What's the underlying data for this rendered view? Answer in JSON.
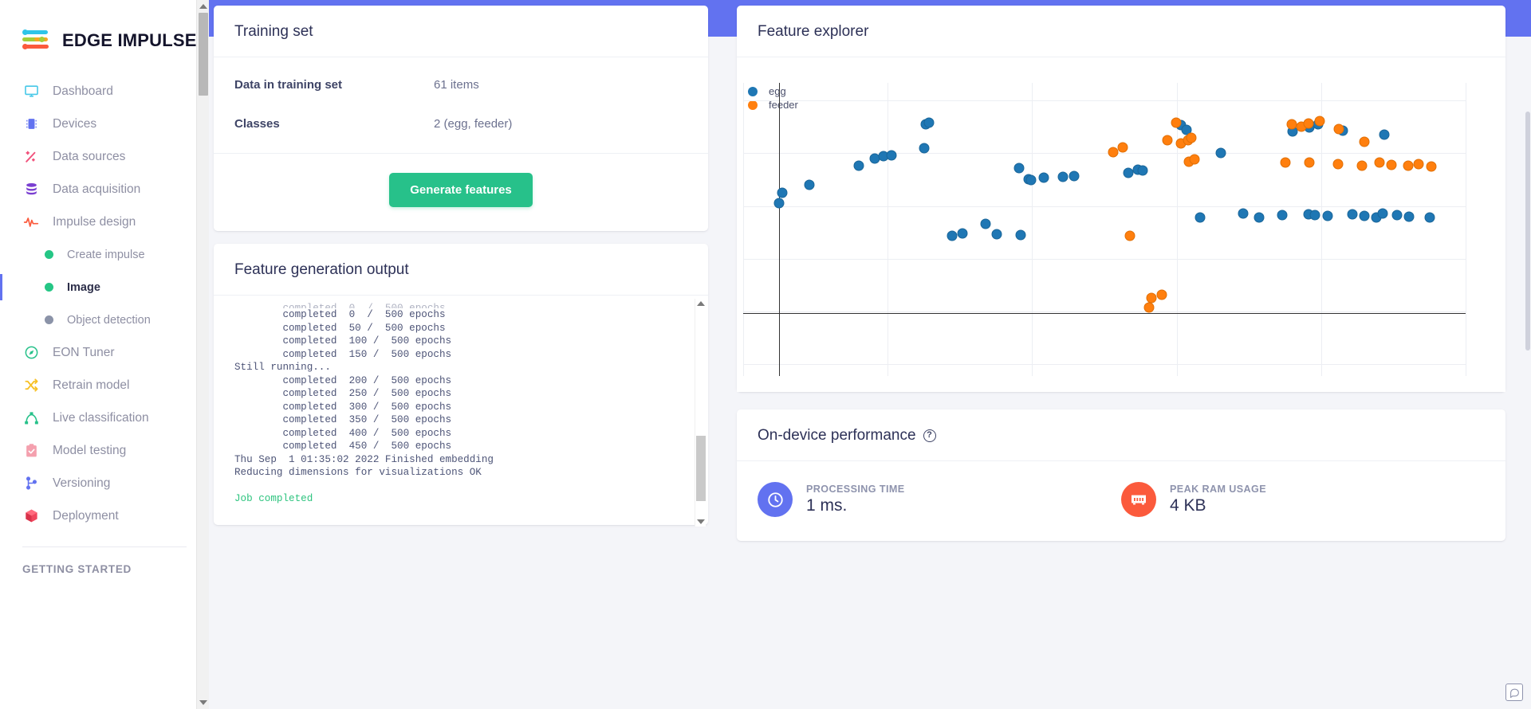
{
  "brand": {
    "name": "EDGE IMPULSE"
  },
  "sidebar": {
    "items": [
      {
        "label": "Dashboard",
        "icon": "monitor-icon"
      },
      {
        "label": "Devices",
        "icon": "chip-icon"
      },
      {
        "label": "Data sources",
        "icon": "wand-icon"
      },
      {
        "label": "Data acquisition",
        "icon": "database-icon"
      },
      {
        "label": "Impulse design",
        "icon": "pulse-icon"
      }
    ],
    "subitems": [
      {
        "label": "Create impulse",
        "state": "green"
      },
      {
        "label": "Image",
        "state": "green",
        "active": true
      },
      {
        "label": "Object detection",
        "state": "grey"
      }
    ],
    "items2": [
      {
        "label": "EON Tuner",
        "icon": "compass-icon"
      },
      {
        "label": "Retrain model",
        "icon": "shuffle-icon"
      },
      {
        "label": "Live classification",
        "icon": "graph-icon"
      },
      {
        "label": "Model testing",
        "icon": "clipboard-check-icon"
      },
      {
        "label": "Versioning",
        "icon": "branch-icon"
      },
      {
        "label": "Deployment",
        "icon": "cube-icon"
      }
    ],
    "section_getting_started": "GETTING STARTED"
  },
  "training_set": {
    "title": "Training set",
    "rows": [
      {
        "key": "Data in training set",
        "value": "61 items"
      },
      {
        "key": "Classes",
        "value": "2 (egg, feeder)"
      }
    ],
    "generate_button": "Generate features"
  },
  "feature_output": {
    "title": "Feature generation output",
    "log": "        completed  0  /  500 epochs\n        completed  50 /  500 epochs\n        completed  100 /  500 epochs\n        completed  150 /  500 epochs\nStill running...\n        completed  200 /  500 epochs\n        completed  250 /  500 epochs\n        completed  300 /  500 epochs\n        completed  350 /  500 epochs\n        completed  400 /  500 epochs\n        completed  450 /  500 epochs\nThu Sep  1 01:35:02 2022 Finished embedding\nReducing dimensions for visualizations OK\n",
    "job_completed": "Job completed"
  },
  "feature_explorer": {
    "title": "Feature explorer"
  },
  "performance": {
    "title": "On-device performance",
    "help": "?",
    "metrics": [
      {
        "label": "PROCESSING TIME",
        "value": "1 ms.",
        "icon": "clock-icon",
        "color": "#6272f0"
      },
      {
        "label": "PEAK RAM USAGE",
        "value": "4 KB",
        "icon": "ram-icon",
        "color": "#fb5a3c"
      }
    ]
  },
  "chart_data": {
    "type": "scatter",
    "title": "Feature explorer",
    "xlabel": "",
    "ylabel": "",
    "grid": true,
    "legend_position": "top-left",
    "legend": [
      {
        "name": "egg",
        "color": "#1f77b4"
      },
      {
        "name": "feeder",
        "color": "#ff7f0e"
      }
    ],
    "xlim": [
      0,
      100
    ],
    "ylim": [
      0,
      100
    ],
    "series": [
      {
        "name": "egg",
        "color": "#1f77b4",
        "points": [
          [
            5.0,
            58.9
          ],
          [
            5.4,
            62.4
          ],
          [
            9.2,
            65.3
          ],
          [
            16.0,
            71.8
          ],
          [
            18.2,
            74.2
          ],
          [
            19.4,
            75.0
          ],
          [
            20.5,
            75.2
          ],
          [
            25.0,
            77.7
          ],
          [
            25.3,
            86.0
          ],
          [
            25.7,
            86.5
          ],
          [
            28.9,
            47.9
          ],
          [
            30.4,
            48.6
          ],
          [
            35.1,
            48.4
          ],
          [
            38.4,
            48.0
          ],
          [
            33.5,
            52.0
          ],
          [
            38.2,
            70.8
          ],
          [
            39.5,
            67.1
          ],
          [
            39.8,
            66.8
          ],
          [
            41.6,
            67.6
          ],
          [
            44.3,
            68.0
          ],
          [
            45.8,
            68.2
          ],
          [
            53.3,
            69.4
          ],
          [
            54.6,
            70.3
          ],
          [
            55.3,
            70.1
          ],
          [
            63.2,
            54.0
          ],
          [
            66.1,
            76.2
          ],
          [
            69.2,
            55.3
          ],
          [
            71.4,
            54.2
          ],
          [
            74.6,
            55.0
          ],
          [
            78.3,
            55.2
          ],
          [
            79.1,
            54.9
          ],
          [
            80.9,
            54.6
          ],
          [
            84.3,
            55.1
          ],
          [
            86.0,
            54.6
          ],
          [
            87.6,
            54.2
          ],
          [
            88.5,
            55.3
          ],
          [
            90.5,
            54.8
          ],
          [
            92.2,
            54.4
          ],
          [
            95.0,
            54.2
          ],
          [
            60.6,
            85.5
          ],
          [
            61.4,
            84.0
          ],
          [
            76.1,
            83.5
          ],
          [
            78.4,
            84.8
          ],
          [
            79.6,
            85.9
          ],
          [
            83.0,
            83.6
          ],
          [
            88.7,
            82.3
          ]
        ]
      },
      {
        "name": "feeder",
        "color": "#ff7f0e",
        "points": [
          [
            53.5,
            47.9
          ],
          [
            56.5,
            26.5
          ],
          [
            58.0,
            27.7
          ],
          [
            56.2,
            23.4
          ],
          [
            59.9,
            86.5
          ],
          [
            58.7,
            80.4
          ],
          [
            60.6,
            79.3
          ],
          [
            61.6,
            80.4
          ],
          [
            62.0,
            81.2
          ],
          [
            61.7,
            73.0
          ],
          [
            62.5,
            73.8
          ],
          [
            52.5,
            78.0
          ],
          [
            51.2,
            76.4
          ],
          [
            75.9,
            85.8
          ],
          [
            77.3,
            85.1
          ],
          [
            78.3,
            86.2
          ],
          [
            79.8,
            87.0
          ],
          [
            82.5,
            84.3
          ],
          [
            86.0,
            79.9
          ],
          [
            75.0,
            72.7
          ],
          [
            78.4,
            72.8
          ],
          [
            82.3,
            72.4
          ],
          [
            85.6,
            71.8
          ],
          [
            88.1,
            72.7
          ],
          [
            89.7,
            72.0
          ],
          [
            92.0,
            71.8
          ],
          [
            93.5,
            72.3
          ],
          [
            95.3,
            71.6
          ]
        ]
      }
    ]
  }
}
